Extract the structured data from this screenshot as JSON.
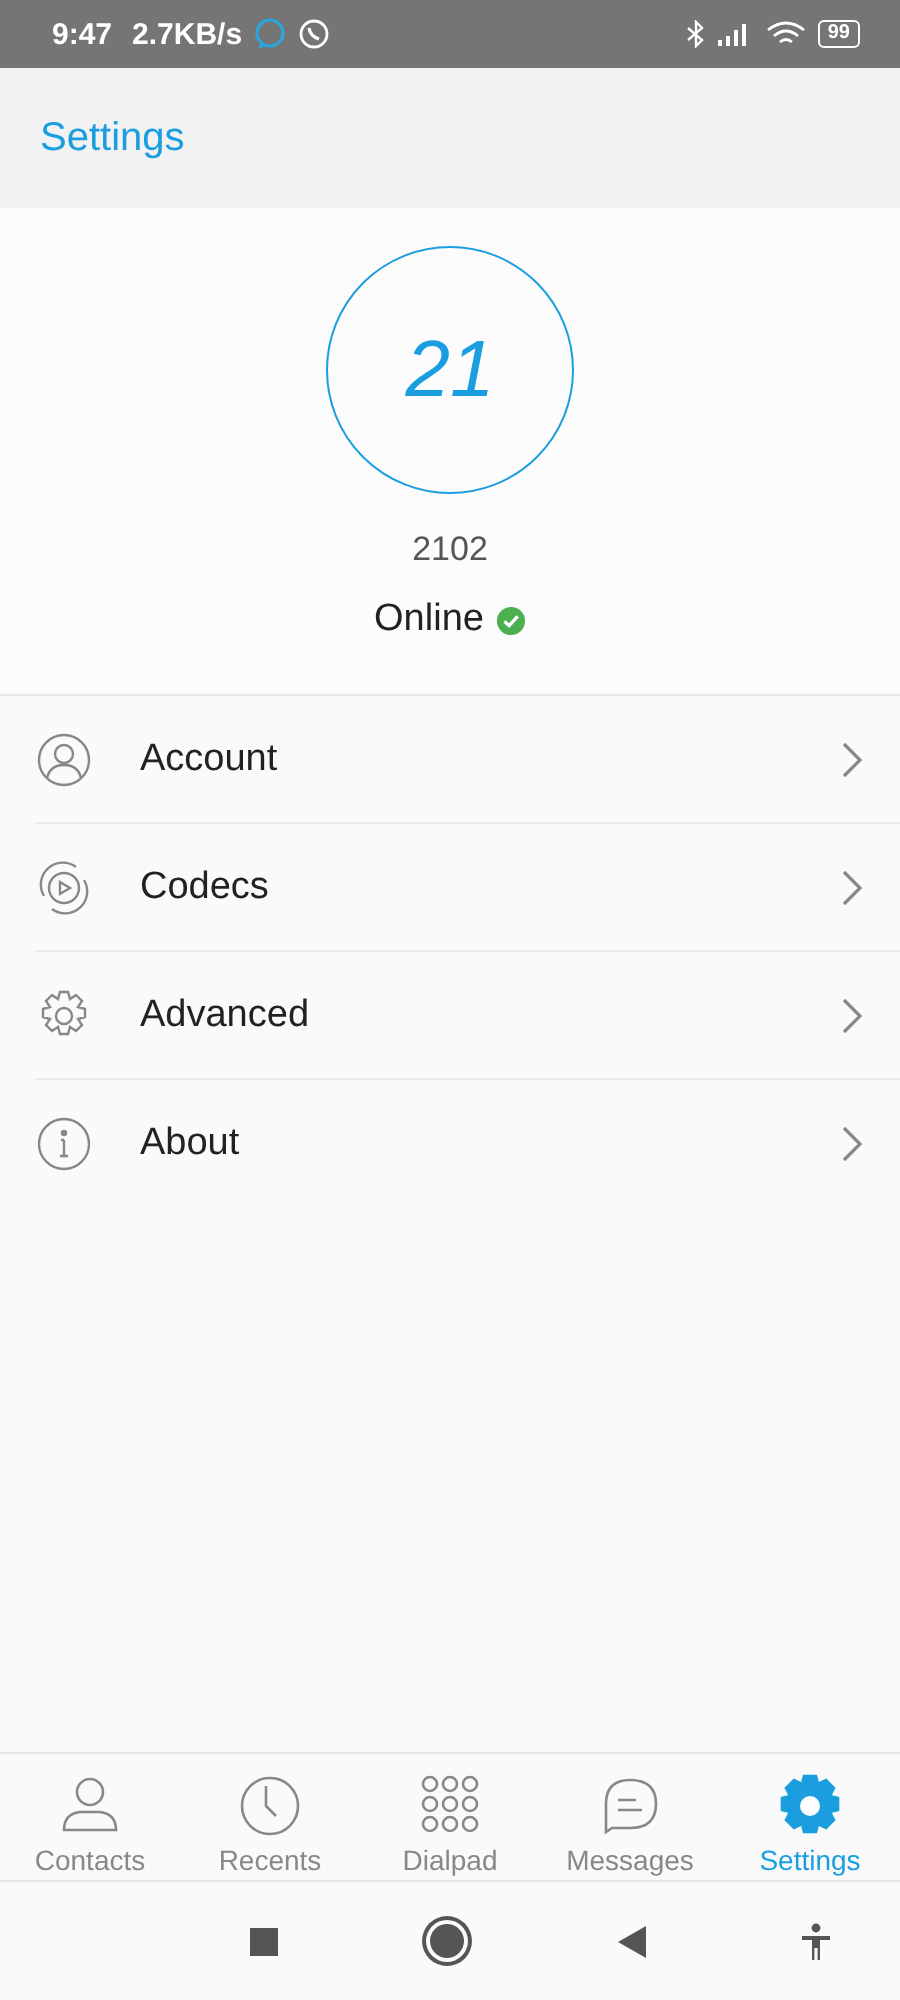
{
  "status_bar": {
    "time": "9:47",
    "speed": "2.7KB/s",
    "battery": "99"
  },
  "header": {
    "title": "Settings"
  },
  "profile": {
    "avatar_text": "21",
    "number": "2102",
    "status": "Online",
    "online": true
  },
  "menu": [
    {
      "label": "Account",
      "kind": "person"
    },
    {
      "label": "Codecs",
      "kind": "codec"
    },
    {
      "label": "Advanced",
      "kind": "gear"
    },
    {
      "label": "About",
      "kind": "info"
    }
  ],
  "tabs": [
    {
      "label": "Contacts",
      "kind": "person",
      "selected": false
    },
    {
      "label": "Recents",
      "kind": "clock",
      "selected": false
    },
    {
      "label": "Dialpad",
      "kind": "dialpad",
      "selected": false
    },
    {
      "label": "Messages",
      "kind": "message",
      "selected": false
    },
    {
      "label": "Settings",
      "kind": "gear",
      "selected": true
    }
  ]
}
